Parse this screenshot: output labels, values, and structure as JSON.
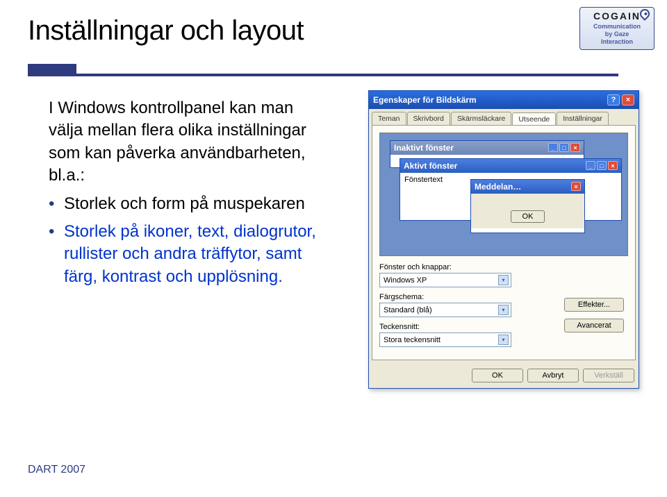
{
  "title": "Inställningar och layout",
  "intro": "I Windows kontrollpanel kan man välja mellan flera olika inställningar som kan påverka användbarheten, bl.a.:",
  "bullets": [
    {
      "plain": "Storlek och form på muspekaren"
    },
    {
      "colored": "Storlek på ikoner, text, dialogrutor, rullister och andra träffytor, samt färg, kontrast och upplösning."
    }
  ],
  "footer": "DART 2007",
  "logo": {
    "name": "COGAIN",
    "tag1": "Communication",
    "tag2": "by Gaze",
    "tag3": "Interaction"
  },
  "dialog": {
    "title": "Egenskaper för Bildskärm",
    "help": "?",
    "close": "×",
    "tabs": [
      "Teman",
      "Skrivbord",
      "Skärmsläckare",
      "Utseende",
      "Inställningar"
    ],
    "activeTab": "Utseende",
    "preview": {
      "inactive": "Inaktivt fönster",
      "active": "Aktivt fönster",
      "bodyText": "Fönstertext",
      "msgTitle": "Meddelan…",
      "ok": "OK"
    },
    "form": {
      "l1": "Fönster och knappar:",
      "v1": "Windows XP",
      "l2": "Färgschema:",
      "v2": "Standard (blå)",
      "l3": "Teckensnitt:",
      "v3": "Stora teckensnitt"
    },
    "sideBtns": {
      "effects": "Effekter...",
      "advanced": "Avancerat"
    },
    "bottom": {
      "ok": "OK",
      "cancel": "Avbryt",
      "apply": "Verkställ"
    }
  }
}
